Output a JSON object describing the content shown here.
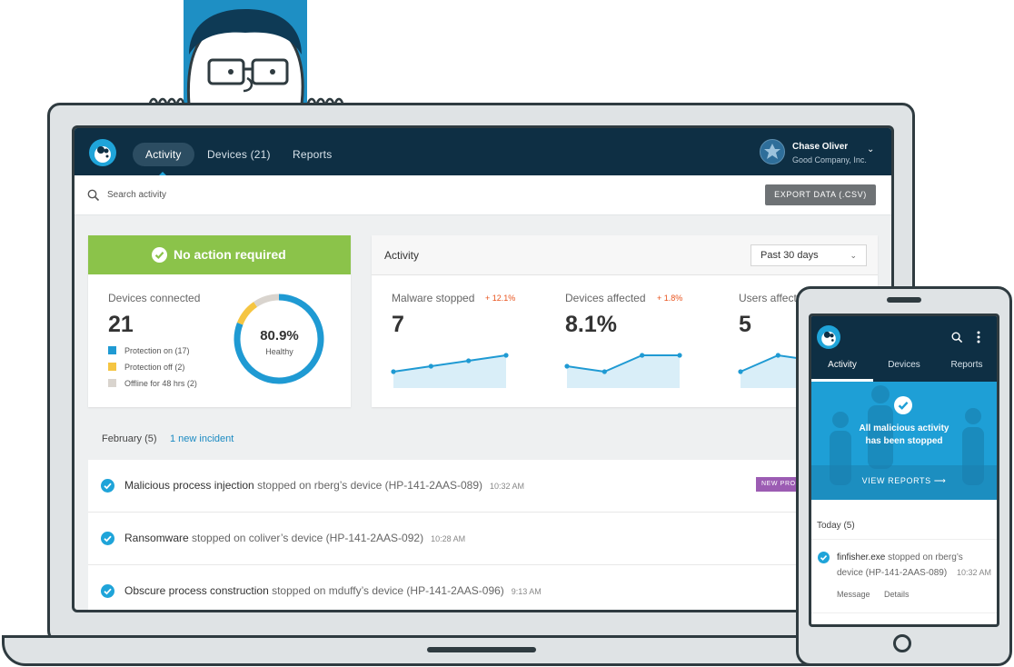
{
  "colors": {
    "nav_bg": "#0e2f44",
    "accent_blue": "#1fa4d9",
    "success_green": "#8bc34a",
    "warning_yellow": "#f5c542",
    "muted_gray": "#d9d4ce",
    "change_red": "#e8531d",
    "badge_purple": "#9c5cb3"
  },
  "nav": {
    "tabs": [
      "Activity",
      "Devices (21)",
      "Reports"
    ],
    "user_name": "Chase Oliver",
    "user_company": "Good Company, Inc."
  },
  "search": {
    "placeholder": "Search activity",
    "export_label": "EXPORT DATA (.CSV)"
  },
  "status": {
    "banner": "No action required",
    "devices_label": "Devices connected",
    "devices_count": "21",
    "legend": [
      {
        "label": "Protection on (17)",
        "color": "#1f9ad3"
      },
      {
        "label": "Protection off (2)",
        "color": "#f5c542"
      },
      {
        "label": "Offline for 48 hrs (2)",
        "color": "#d9d4ce"
      }
    ],
    "donut": {
      "value_text": "80.9%",
      "label": "Healthy",
      "segments": [
        17,
        2,
        2
      ]
    }
  },
  "activity": {
    "title": "Activity",
    "range": "Past 30 days",
    "metrics": [
      {
        "label": "Malware stopped",
        "change": "+ 12.1%",
        "value": "7",
        "trend": [
          2,
          3,
          4,
          5
        ]
      },
      {
        "label": "Devices affected",
        "change": "+ 1.8%",
        "value": "8.1%",
        "trend": [
          4,
          3,
          6,
          6
        ]
      },
      {
        "label": "Users affected",
        "change": "",
        "value": "5",
        "trend": [
          3,
          6,
          5,
          5
        ]
      }
    ]
  },
  "incidents": {
    "month": "February (5)",
    "new_link": "1 new incident",
    "rows": [
      {
        "strong": "Malicious process injection",
        "rest": " stopped on rberg’s device (HP-141-2AAS-089)",
        "time": "10:32 AM",
        "badge": "NEW PROCESS"
      },
      {
        "strong": "Ransomware",
        "rest": " stopped on coliver’s device (HP-141-2AAS-092)",
        "time": "10:28 AM",
        "badge": ""
      },
      {
        "strong": "Obscure process construction",
        "rest": " stopped on mduffy’s device (HP-141-2AAS-096)",
        "time": "9:13 AM",
        "badge": ""
      }
    ]
  },
  "phone": {
    "tabs": [
      "Activity",
      "Devices",
      "Reports"
    ],
    "hero_line1": "All malicious activity",
    "hero_line2": "has been stopped",
    "hero_button": "VIEW REPORTS",
    "today_label": "Today (5)",
    "item_strong": "finfisher.exe",
    "item_rest": " stopped on rberg’s device (HP-141-2AAS-089)",
    "item_time": "10:32 AM",
    "item_actions": [
      "Message",
      "Details"
    ]
  }
}
